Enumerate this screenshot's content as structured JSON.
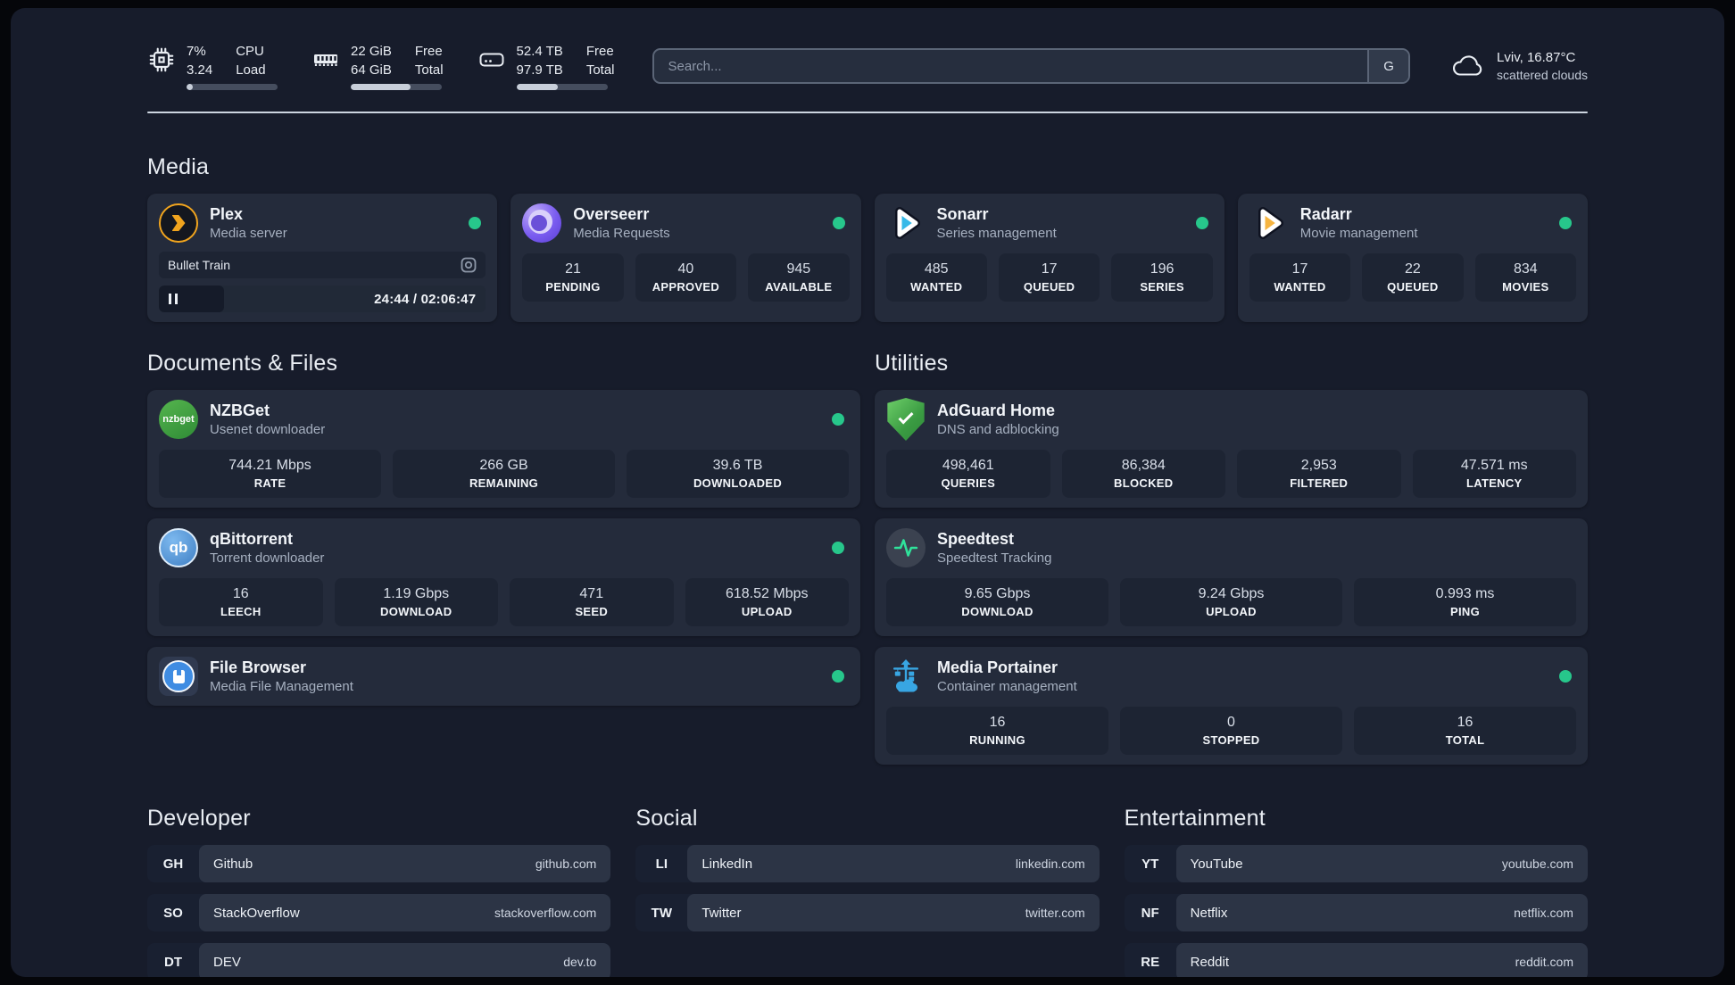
{
  "header": {
    "system_stats": [
      {
        "icon": "cpu-chip-icon",
        "values": [
          "7%",
          "3.24"
        ],
        "labels": [
          "CPU",
          "Load"
        ],
        "progress_percent": 7
      },
      {
        "icon": "memory-icon",
        "values": [
          "22 GiB",
          "64 GiB"
        ],
        "labels": [
          "Free",
          "Total"
        ],
        "progress_percent": 66
      },
      {
        "icon": "storage-icon",
        "values": [
          "52.4 TB",
          "97.9 TB"
        ],
        "labels": [
          "Free",
          "Total"
        ],
        "progress_percent": 46
      }
    ],
    "search": {
      "placeholder": "Search...",
      "provider_badge": "G"
    },
    "weather": {
      "icon": "cloud-icon",
      "location_temp": "Lviv, 16.87°C",
      "condition": "scattered clouds"
    }
  },
  "media": {
    "title": "Media",
    "cards": [
      {
        "icon": "plex-icon",
        "name": "Plex",
        "description": "Media server",
        "status": "online",
        "now_playing": {
          "title": "Bullet Train",
          "time": "24:44 / 02:06:47",
          "progress_percent": 20
        }
      },
      {
        "icon": "overseerr-icon",
        "name": "Overseerr",
        "description": "Media Requests",
        "status": "online",
        "stats": [
          {
            "value": "21",
            "label": "PENDING"
          },
          {
            "value": "40",
            "label": "APPROVED"
          },
          {
            "value": "945",
            "label": "AVAILABLE"
          }
        ]
      },
      {
        "icon": "sonarr-icon",
        "name": "Sonarr",
        "description": "Series management",
        "status": "online",
        "stats": [
          {
            "value": "485",
            "label": "WANTED"
          },
          {
            "value": "17",
            "label": "QUEUED"
          },
          {
            "value": "196",
            "label": "SERIES"
          }
        ]
      },
      {
        "icon": "radarr-icon",
        "name": "Radarr",
        "description": "Movie management",
        "status": "online",
        "stats": [
          {
            "value": "17",
            "label": "WANTED"
          },
          {
            "value": "22",
            "label": "QUEUED"
          },
          {
            "value": "834",
            "label": "MOVIES"
          }
        ]
      }
    ]
  },
  "documents": {
    "title": "Documents & Files",
    "cards": [
      {
        "icon": "nzbget-icon",
        "name": "NZBGet",
        "description": "Usenet downloader",
        "status": "online",
        "stats": [
          {
            "value": "744.21 Mbps",
            "label": "RATE"
          },
          {
            "value": "266 GB",
            "label": "REMAINING"
          },
          {
            "value": "39.6 TB",
            "label": "DOWNLOADED"
          }
        ]
      },
      {
        "icon": "qbittorrent-icon",
        "name": "qBittorrent",
        "description": "Torrent downloader",
        "status": "online",
        "stats": [
          {
            "value": "16",
            "label": "LEECH"
          },
          {
            "value": "1.19 Gbps",
            "label": "DOWNLOAD"
          },
          {
            "value": "471",
            "label": "SEED"
          },
          {
            "value": "618.52 Mbps",
            "label": "UPLOAD"
          }
        ]
      },
      {
        "icon": "filebrowser-icon",
        "name": "File Browser",
        "description": "Media File Management",
        "status": "online"
      }
    ]
  },
  "utilities": {
    "title": "Utilities",
    "cards": [
      {
        "icon": "adguard-icon",
        "name": "AdGuard Home",
        "description": "DNS and adblocking",
        "stats": [
          {
            "value": "498,461",
            "label": "QUERIES"
          },
          {
            "value": "86,384",
            "label": "BLOCKED"
          },
          {
            "value": "2,953",
            "label": "FILTERED"
          },
          {
            "value": "47.571 ms",
            "label": "LATENCY"
          }
        ]
      },
      {
        "icon": "speedtest-icon",
        "name": "Speedtest",
        "description": "Speedtest Tracking",
        "stats": [
          {
            "value": "9.65 Gbps",
            "label": "DOWNLOAD"
          },
          {
            "value": "9.24 Gbps",
            "label": "UPLOAD"
          },
          {
            "value": "0.993 ms",
            "label": "PING"
          }
        ]
      },
      {
        "icon": "portainer-icon",
        "name": "Media Portainer",
        "description": "Container management",
        "status": "online",
        "stats": [
          {
            "value": "16",
            "label": "RUNNING"
          },
          {
            "value": "0",
            "label": "STOPPED"
          },
          {
            "value": "16",
            "label": "TOTAL"
          }
        ]
      }
    ]
  },
  "bookmarks": [
    {
      "title": "Developer",
      "links": [
        {
          "abbr": "GH",
          "name": "Github",
          "url": "github.com"
        },
        {
          "abbr": "SO",
          "name": "StackOverflow",
          "url": "stackoverflow.com"
        },
        {
          "abbr": "DT",
          "name": "DEV",
          "url": "dev.to"
        }
      ]
    },
    {
      "title": "Social",
      "links": [
        {
          "abbr": "LI",
          "name": "LinkedIn",
          "url": "linkedin.com"
        },
        {
          "abbr": "TW",
          "name": "Twitter",
          "url": "twitter.com"
        }
      ]
    },
    {
      "title": "Entertainment",
      "links": [
        {
          "abbr": "YT",
          "name": "YouTube",
          "url": "youtube.com"
        },
        {
          "abbr": "NF",
          "name": "Netflix",
          "url": "netflix.com"
        },
        {
          "abbr": "RE",
          "name": "Reddit",
          "url": "reddit.com"
        }
      ]
    }
  ],
  "colors": {
    "status_online": "#27c78b",
    "plex_orange": "#f0a41e",
    "sonarr_blue": "#36b9e8",
    "radarr_yellow": "#f6b440",
    "portainer_blue": "#38a6e3",
    "adguard_green": "#52b654",
    "speedtest_green": "#2fe39b",
    "page_background": "#171c2b",
    "card_background": "#242b3b"
  }
}
